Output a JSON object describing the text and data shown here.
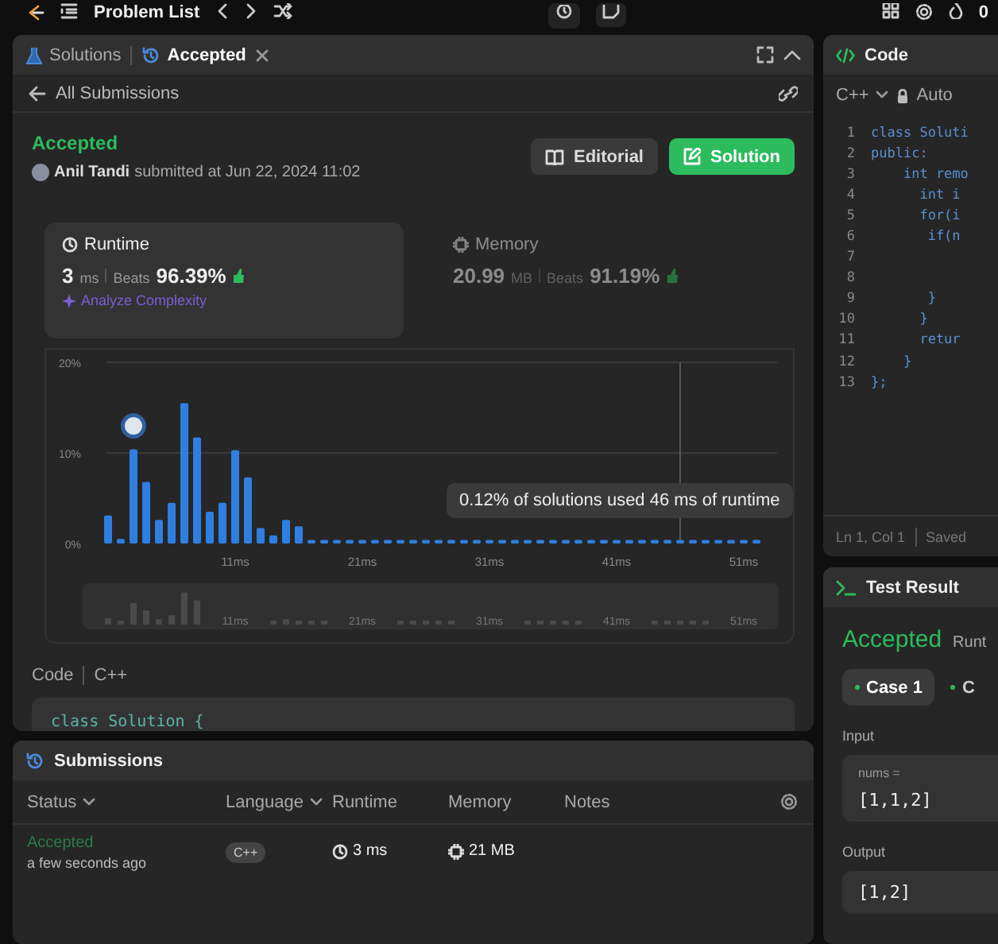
{
  "top_bar": {
    "nav_label": "Problem List",
    "streak": "0"
  },
  "solution_panel": {
    "tabs": [
      {
        "label": "Solutions",
        "selected": false,
        "closable": false
      },
      {
        "label": "Accepted",
        "selected": true,
        "closable": true
      }
    ],
    "back_link": "All Submissions",
    "status": "Accepted",
    "author": "Anil Tandi",
    "submitted": "submitted at Jun 22, 2024 11:02",
    "buttons": [
      {
        "label": "Editorial",
        "kind": "secondary"
      },
      {
        "label": "Solution",
        "kind": "primary"
      }
    ],
    "stats": [
      {
        "title": "Runtime",
        "value": "3",
        "unit": "ms",
        "beats_label": "Beats",
        "beats": "96.39%",
        "selected": true,
        "link": "Analyze Complexity"
      },
      {
        "title": "Memory",
        "value": "20.99",
        "unit": "MB",
        "beats_label": "Beats",
        "beats": "91.19%",
        "selected": false
      }
    ],
    "chart_data": {
      "type": "bar",
      "x": [
        1,
        2,
        3,
        4,
        5,
        6,
        7,
        8,
        9,
        10,
        11,
        12,
        13,
        14,
        15,
        16,
        17,
        18,
        19,
        20,
        21,
        22,
        23,
        24,
        25,
        26,
        27,
        28,
        29,
        30,
        31,
        32,
        33,
        34,
        35,
        36,
        37,
        38,
        39,
        40,
        41,
        42,
        43,
        44,
        45,
        46,
        47,
        48,
        49,
        50,
        51,
        52
      ],
      "series": [
        {
          "color": "#2f7fe0",
          "values": [
            3.1,
            0.5,
            10.4,
            6.8,
            2.6,
            4.5,
            15.5,
            11.7,
            3.5,
            4.5,
            10.3,
            7.3,
            1.7,
            0.9,
            2.6,
            1.9,
            0.4,
            0.4,
            0.4,
            0.4,
            0.4,
            0.4,
            0.4,
            0.4,
            0.4,
            0.4,
            0.4,
            0.4,
            0.4,
            0.4,
            0.4,
            0.4,
            0.4,
            0.4,
            0.4,
            0.4,
            0.4,
            0.4,
            0.4,
            0.4,
            0.4,
            0.4,
            0.4,
            0.4,
            0.4,
            0.4,
            0.4,
            0.4,
            0.4,
            0.4,
            0.4,
            0.4
          ]
        }
      ],
      "xlim": [
        0.5,
        52.5
      ],
      "ylim": [
        0,
        20
      ],
      "ref_lines": [
        {
          "axis": "x",
          "value": 46
        }
      ],
      "xticks": [
        {
          "value": 11,
          "label": "11ms"
        },
        {
          "value": 21,
          "label": "21ms"
        },
        {
          "value": 31,
          "label": "31ms"
        },
        {
          "value": 41,
          "label": "41ms"
        },
        {
          "value": 51,
          "label": "51ms"
        }
      ],
      "yticks": [
        {
          "value": 0,
          "label": "0%"
        },
        {
          "value": 10,
          "label": "10%"
        },
        {
          "value": 20,
          "label": "20%"
        }
      ]
    },
    "tooltip": "0.12% of solutions used 46 ms of runtime",
    "overview_labels": [
      "11ms",
      "21ms",
      "31ms",
      "41ms",
      "51ms"
    ],
    "code_label": "Code",
    "code_language": "C++",
    "code_lines": [
      "class Solution {"
    ]
  },
  "submissions_panel": {
    "title": "Submissions",
    "columns": [
      {
        "label": "Status",
        "sortable": true
      },
      {
        "label": "Language",
        "sortable": true
      },
      {
        "label": "Runtime",
        "sortable": false
      },
      {
        "label": "Memory",
        "sortable": false
      },
      {
        "label": "Notes",
        "sortable": false
      }
    ],
    "rows": [
      {
        "status": "Accepted",
        "time": "a few seconds ago",
        "language": "C++",
        "runtime": "3 ms",
        "memory": "21 MB"
      }
    ]
  },
  "editor": {
    "title": "Code",
    "language": "C++",
    "mode": "Auto",
    "lines": [
      {
        "number": "1",
        "text": "class Soluti"
      },
      {
        "number": "2",
        "text": "public:"
      },
      {
        "number": "3",
        "text": "    int remo"
      },
      {
        "number": "4",
        "text": "      int i"
      },
      {
        "number": "5",
        "text": "      for(i"
      },
      {
        "number": "6",
        "text": "       if(n"
      },
      {
        "number": "7"
      },
      {
        "number": "8"
      },
      {
        "number": "9",
        "text": "       }"
      },
      {
        "number": "10",
        "text": "      }"
      },
      {
        "number": "11",
        "text": "      retur"
      },
      {
        "number": "12",
        "text": "    }"
      },
      {
        "number": "13",
        "text": "};"
      }
    ],
    "position": "Ln 1, Col 1",
    "save_state": "Saved"
  },
  "test_result": {
    "title": "Test Result",
    "status": "Accepted",
    "runtime_label": "Runt",
    "cases": [
      {
        "label": "Case 1",
        "selected": true
      },
      {
        "label": "C",
        "selected": false
      }
    ],
    "input_label": "Input",
    "param_name": "nums =",
    "param_value": "[1,1,2]",
    "output_label": "Output",
    "output_value": "[1,2]"
  }
}
